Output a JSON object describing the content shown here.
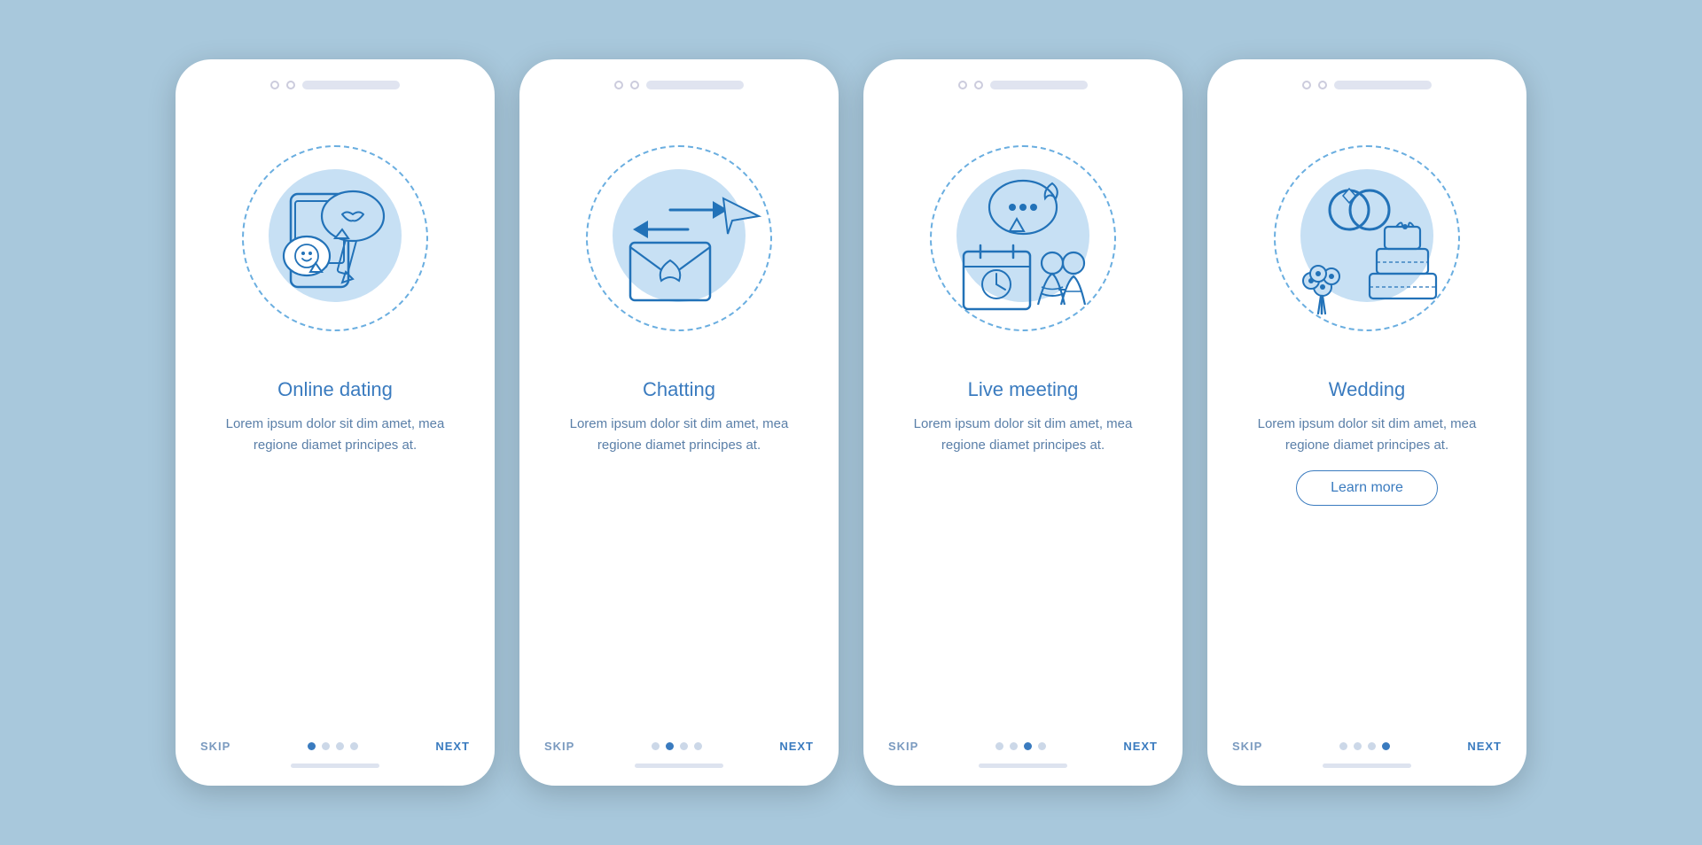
{
  "cards": [
    {
      "id": "online-dating",
      "title": "Online dating",
      "body": "Lorem ipsum dolor sit dim amet, mea regione diamet principes at.",
      "activeDot": 0,
      "showLearnMore": false
    },
    {
      "id": "chatting",
      "title": "Chatting",
      "body": "Lorem ipsum dolor sit dim amet, mea regione diamet principes at.",
      "activeDot": 1,
      "showLearnMore": false
    },
    {
      "id": "live-meeting",
      "title": "Live meeting",
      "body": "Lorem ipsum dolor sit dim amet, mea regione diamet principes at.",
      "activeDot": 2,
      "showLearnMore": false
    },
    {
      "id": "wedding",
      "title": "Wedding",
      "body": "Lorem ipsum dolor sit dim amet, mea regione diamet principes at.",
      "activeDot": 3,
      "showLearnMore": true,
      "learnMoreLabel": "Learn more"
    }
  ],
  "nav": {
    "skip": "SKIP",
    "next": "NEXT"
  }
}
